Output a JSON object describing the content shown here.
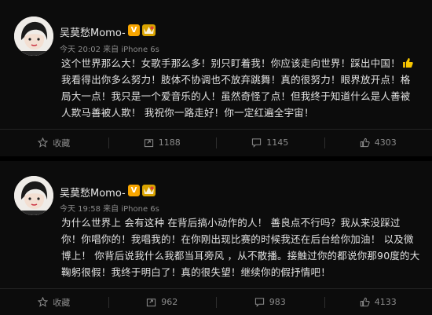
{
  "posts": [
    {
      "username": "吴莫愁Momo-",
      "meta": "今天 20:02 来自 iPhone 6s",
      "content_lines": [
        "这个世界那么大！女歌手那么多！别只盯着我！你应该走向世界！踩出中国！",
        "我看得出你多么努力！肢体不协调也不放弃跳舞！真的很努力！眼界放开点！格",
        "局大一点！我只是一个爱音乐的人！虽然奇怪了点！但我终于知道什么是人善被",
        "人欺马善被人欺！ 我祝你一路走好！你一定红遍全宇宙！"
      ],
      "actions": {
        "favorite": "收藏",
        "share_count": "1188",
        "comment_count": "1145",
        "like_count": "4303"
      }
    },
    {
      "username": "吴莫愁Momo-",
      "meta": "今天 19:58 来自 iPhone 6s",
      "content_lines": [
        "为什么世界上 会有这种 在背后搞小动作的人！ 善良点不行吗？我从来没踩过",
        "你！你唱你的！我唱我的！在你刚出现比赛的时候我还在后台给你加油！ 以及微",
        "博上！ 你背后说我什么我都当耳旁风 ，从不散播。接触过你的都说你那90度的大",
        "鞠躬很假！我终于明白了！真的很失望！继续你的假抒情吧！"
      ],
      "actions": {
        "favorite": "收藏",
        "share_count": "962",
        "comment_count": "983",
        "like_count": "4133"
      }
    }
  ],
  "icons": {
    "verified_badge": "v-verified-icon",
    "vip_badge": "vip-icon",
    "thumbs_up_emoji": "thumbs-up-icon",
    "favorite": "star-icon",
    "share": "share-icon",
    "comment": "comment-icon",
    "like": "like-icon"
  },
  "colors": {
    "background": "#0c0c0c",
    "accent_badge": "#f7a500",
    "yellow_strip": "#f5dc1a"
  }
}
